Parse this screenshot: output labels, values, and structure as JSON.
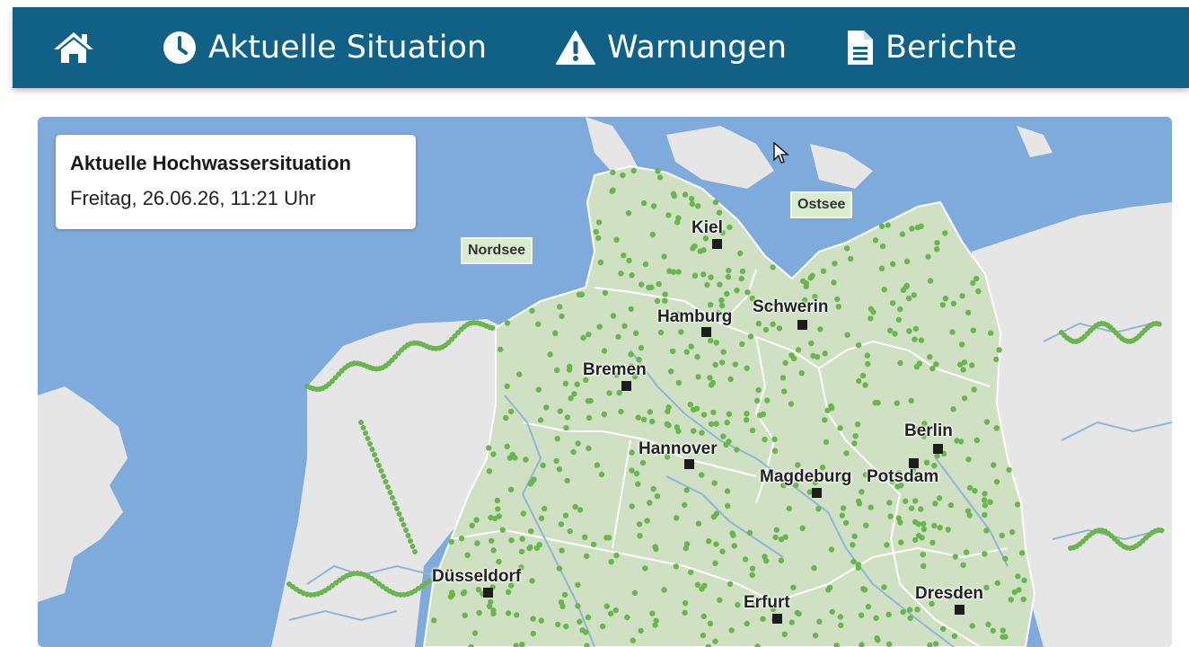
{
  "nav": {
    "home_icon": "home-icon",
    "items": [
      {
        "label": "Aktuelle Situation",
        "icon": "clock-icon"
      },
      {
        "label": "Warnungen",
        "icon": "warning-triangle-icon"
      },
      {
        "label": "Berichte",
        "icon": "document-icon"
      }
    ]
  },
  "info": {
    "title": "Aktuelle Hochwassersituation",
    "date": "Freitag, 26.06.26, 11:21 Uhr"
  },
  "seas": [
    {
      "label": "Nordsee"
    },
    {
      "label": "Ostsee"
    }
  ],
  "cities": [
    {
      "name": "Kiel"
    },
    {
      "name": "Hamburg"
    },
    {
      "name": "Schwerin"
    },
    {
      "name": "Bremen"
    },
    {
      "name": "Berlin"
    },
    {
      "name": "Hannover"
    },
    {
      "name": "Magdeburg"
    },
    {
      "name": "Potsdam"
    },
    {
      "name": "Düsseldorf"
    },
    {
      "name": "Erfurt"
    },
    {
      "name": "Dresden"
    }
  ],
  "colors": {
    "header": "#116186",
    "sea": "#7faadc",
    "land_foreign": "#e6e6e6",
    "land_germany": "#cfe0c3",
    "station_dot": "#6ab64e",
    "station_dot_inactive": "#888888"
  }
}
